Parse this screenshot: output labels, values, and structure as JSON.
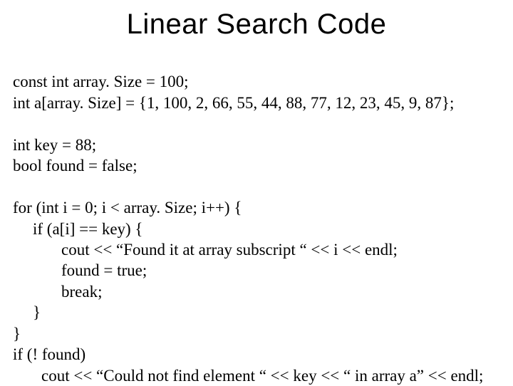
{
  "title": "Linear Search Code",
  "lines": {
    "l1": "const int array. Size = 100;",
    "l2": "int a[array. Size] = {1, 100, 2, 66, 55, 44, 88, 77, 12, 23, 45, 9, 87};",
    "l3": "int key = 88;",
    "l4": "bool found = false;",
    "l5": "for (int i = 0; i < array. Size; i++) {",
    "l6": "if (a[i] == key) {",
    "l7": "cout << “Found it at array subscript “ << i << endl;",
    "l8": "found = true;",
    "l9": "break;",
    "l10": "}",
    "l11": "}",
    "l12": "if (! found)",
    "l13": "cout << “Could not find element “ << key << “ in array a” << endl;"
  }
}
